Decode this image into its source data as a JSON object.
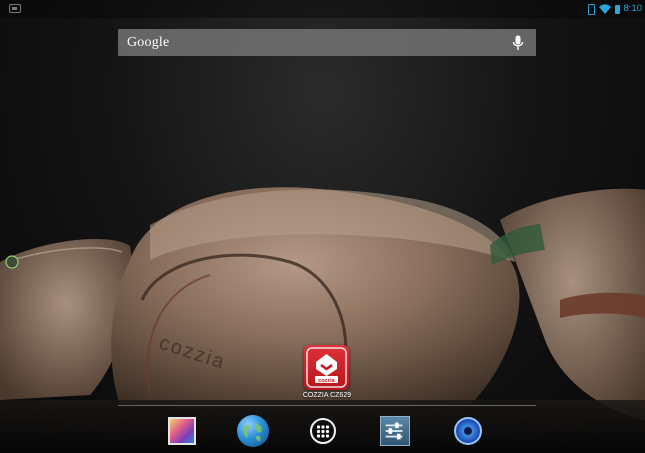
{
  "status_bar": {
    "time": "8:10",
    "icons": [
      "screenshot-notification-icon",
      "vibrate-icon",
      "wifi-icon",
      "battery-icon"
    ],
    "accent_color": "#2aa6d9"
  },
  "search_widget": {
    "logo_text": "Google",
    "mic_icon": "mic-icon"
  },
  "wallpaper": {
    "brand_text": "cozzia"
  },
  "home_apps": [
    {
      "label": "COZZIA CZ629",
      "icon": "cozzia-app-icon",
      "icon_text": "cozzia"
    }
  ],
  "dock": {
    "items": [
      {
        "name": "gallery",
        "icon": "gallery-icon"
      },
      {
        "name": "browser",
        "icon": "globe-icon"
      },
      {
        "name": "all-apps",
        "icon": "app-drawer-icon"
      },
      {
        "name": "settings",
        "icon": "settings-icon"
      },
      {
        "name": "music",
        "icon": "music-icon"
      }
    ]
  }
}
